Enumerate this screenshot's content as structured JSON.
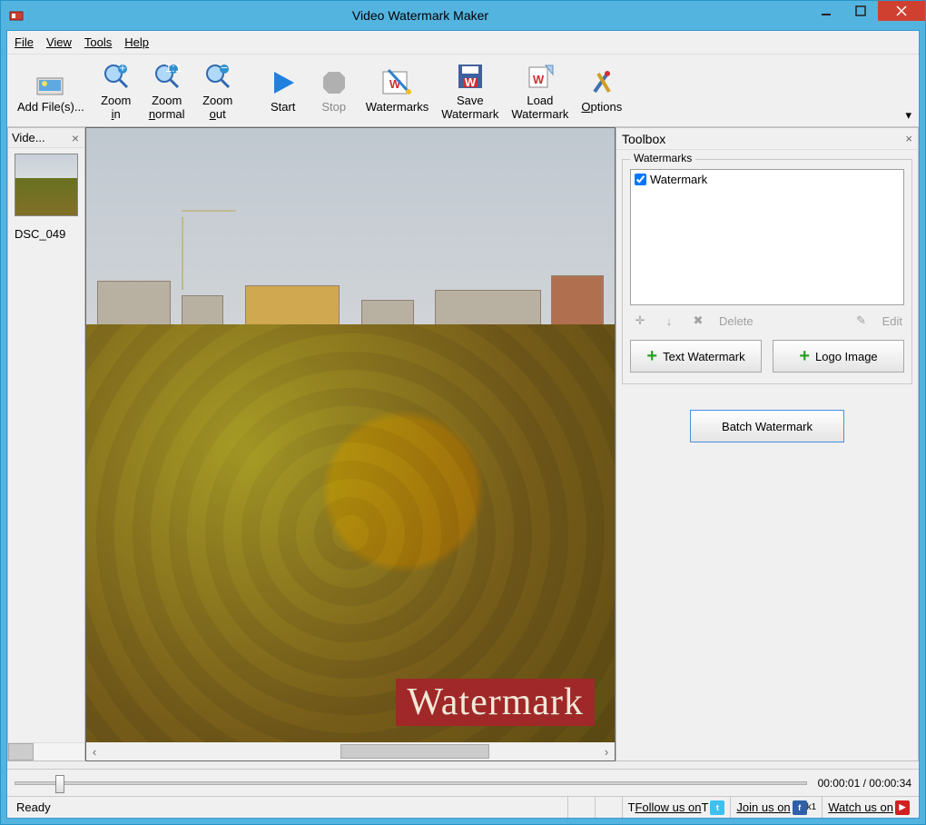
{
  "app": {
    "title": "Video Watermark Maker"
  },
  "menu": {
    "file": "File",
    "view": "View",
    "tools": "Tools",
    "help": "Help"
  },
  "toolbar": {
    "add_files": "Add File(s)...",
    "zoom_in": "Zoom in",
    "zoom_normal": "Zoom normal",
    "zoom_out": "Zoom out",
    "start": "Start",
    "stop": "Stop",
    "watermarks": "Watermarks",
    "save_wm": "Save Watermark",
    "load_wm": "Load Watermark",
    "options": "Options"
  },
  "left_panel": {
    "title": "Vide...",
    "thumb_label": "DSC_049"
  },
  "preview": {
    "watermark_text": "Watermark"
  },
  "toolbox": {
    "title": "Toolbox",
    "group_label": "Watermarks",
    "items": [
      {
        "label": "Watermark",
        "checked": true
      }
    ],
    "delete": "Delete",
    "edit": "Edit",
    "text_wm": "Text Watermark",
    "logo_img": "Logo Image",
    "batch": "Batch Watermark"
  },
  "timeline": {
    "time": "00:00:01 / 00:00:34"
  },
  "statusbar": {
    "ready": "Ready",
    "follow": "Follow us on",
    "join": "Join us on",
    "watch": "Watch us on"
  }
}
